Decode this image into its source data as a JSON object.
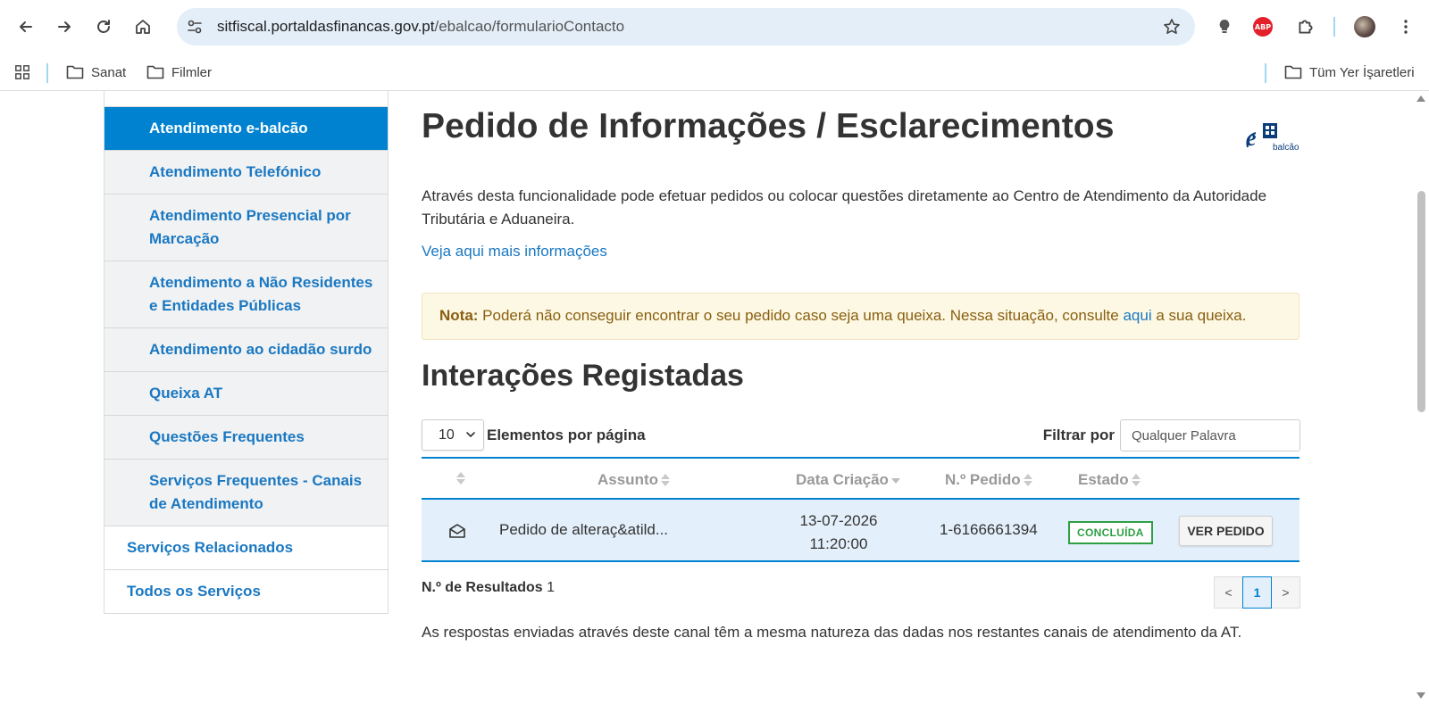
{
  "browser": {
    "url_host": "sitfiscal.portaldasfinancas.gov.pt",
    "url_path": "/ebalcao/formularioContacto",
    "bookmarks": [
      {
        "label": "Sanat"
      },
      {
        "label": "Filmler"
      }
    ],
    "all_bookmarks_label": "Tüm Yer İşaretleri",
    "extension_abp_label": "ABP"
  },
  "sidebar": {
    "items": [
      {
        "label": "Atendimento e-balcão",
        "active": true
      },
      {
        "label": "Atendimento Telefónico"
      },
      {
        "label": "Atendimento Presencial por Marcação"
      },
      {
        "label": "Atendimento a Não Residentes e Entidades Públicas"
      },
      {
        "label": "Atendimento ao cidadão surdo"
      },
      {
        "label": "Queixa AT"
      },
      {
        "label": "Questões Frequentes"
      },
      {
        "label": "Serviços Frequentes - Canais de Atendimento"
      }
    ],
    "main_items": [
      {
        "label": "Serviços Relacionados"
      },
      {
        "label": "Todos os Serviços"
      }
    ]
  },
  "main": {
    "title": "Pedido de Informações / Esclarecimentos",
    "logo_text": "balcão",
    "logo_letter": "e",
    "intro": "Através desta funcionalidade pode efetuar pedidos ou colocar questões diretamente ao Centro de Atendimento da Autoridade Tributária e Aduaneira.",
    "more_info_link": "Veja aqui mais informações",
    "note": {
      "label": "Nota:",
      "text_before": " Poderá não conseguir encontrar o seu pedido caso seja uma queixa. Nessa situação, consulte ",
      "link": "aqui",
      "text_after": " a sua queixa."
    },
    "section_title": "Interações Registadas",
    "per_page": {
      "value": "10",
      "label": "Elementos por página"
    },
    "filter": {
      "label": "Filtrar por",
      "placeholder": "Qualquer Palavra"
    },
    "table": {
      "headers": {
        "assunto": "Assunto",
        "data": "Data Criação",
        "pedido": "N.º Pedido",
        "estado": "Estado"
      },
      "rows": [
        {
          "assunto": "Pedido de alteraç&atild...",
          "data_date": "13-07-2026",
          "data_time": "11:20:00",
          "pedido": "1-6166661394",
          "estado": "CONCLUÍDA",
          "action": "VER PEDIDO"
        }
      ]
    },
    "results": {
      "label": "N.º de Resultados",
      "count": "1"
    },
    "pager": {
      "prev": "<",
      "current": "1",
      "next": ">"
    },
    "footnote": "As respostas enviadas através deste canal têm a mesma natureza das dadas nos restantes canais de atendimento da AT."
  },
  "colors": {
    "accent": "#0082d0",
    "link": "#1a78c2",
    "note_bg": "#fcf8e3",
    "status_ok": "#2ea043",
    "row_highlight": "#e3effa"
  }
}
